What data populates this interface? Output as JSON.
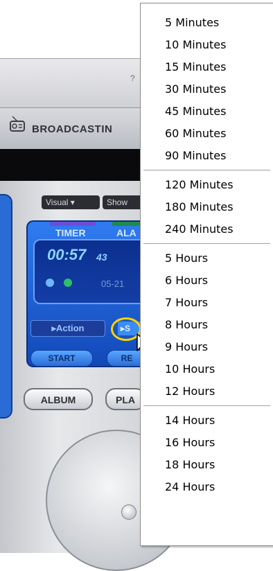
{
  "player": {
    "brand": "BROADCASTIN",
    "help_glyph": "?",
    "pills": {
      "visual": "Visual ▾",
      "show": "Show"
    },
    "tabs": {
      "timer": "TIMER",
      "alarm": "ALA"
    },
    "lcd": {
      "time": "00:57",
      "seconds": "43",
      "date": "05-21"
    },
    "buttons": {
      "action": "▸Action",
      "set": "▸S",
      "start": "START",
      "reset": "RE",
      "album": "ALBUM",
      "playlist": "PLA"
    },
    "colors": {
      "lcd_text": "#8fd3ff",
      "highlight_ring": "#ffd400",
      "panel_blue": "#1f5fd8"
    }
  },
  "menu": {
    "groups": [
      [
        "5 Minutes",
        "10 Minutes",
        "15 Minutes",
        "30 Minutes",
        "45 Minutes",
        "60 Minutes",
        "90 Minutes"
      ],
      [
        "120 Minutes",
        "180 Minutes",
        "240 Minutes"
      ],
      [
        "5 Hours",
        "6 Hours",
        "7 Hours",
        "8 Hours",
        "9 Hours",
        "10 Hours",
        "12 Hours"
      ],
      [
        "14 Hours",
        "16 Hours",
        "18 Hours",
        "24 Hours"
      ]
    ]
  }
}
